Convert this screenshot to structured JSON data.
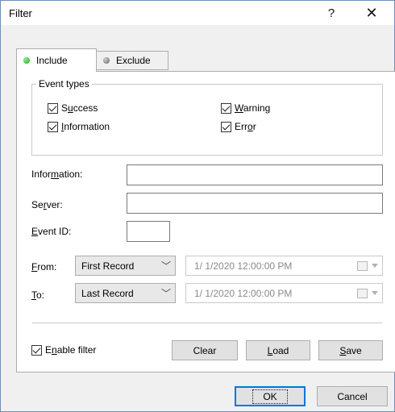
{
  "window": {
    "title": "Filter",
    "help_label": "?",
    "close_label": "✕"
  },
  "tabs": [
    {
      "label": "Include",
      "icon": "green-dot-icon",
      "active": true
    },
    {
      "label": "Exclude",
      "icon": "gray-dot-icon",
      "active": false
    }
  ],
  "event_types": {
    "legend": "Event types",
    "items": [
      {
        "pre": "S",
        "acc": "u",
        "post": "ccess",
        "checked": true
      },
      {
        "pre": "",
        "acc": "I",
        "post": "nformation",
        "checked": true
      },
      {
        "pre": "",
        "acc": "W",
        "post": "arning",
        "checked": true
      },
      {
        "pre": "Err",
        "acc": "o",
        "post": "r",
        "checked": true
      }
    ]
  },
  "fields": {
    "information": {
      "pre": "Infor",
      "acc": "m",
      "post": "ation:",
      "value": ""
    },
    "server": {
      "pre": "Se",
      "acc": "r",
      "post": "ver:",
      "value": ""
    },
    "event_id": {
      "pre": "",
      "acc": "E",
      "post": "vent ID:",
      "value": ""
    }
  },
  "range": {
    "from": {
      "pre": "",
      "acc": "F",
      "post": "rom:",
      "select": "First Record",
      "date": "1/  1/2020 12:00:00 PM"
    },
    "to": {
      "pre": "",
      "acc": "T",
      "post": "o:",
      "select": "Last Record",
      "date": "1/  1/2020 12:00:00 PM"
    }
  },
  "enable_filter": {
    "pre": "E",
    "acc": "n",
    "post": "able filter",
    "checked": true
  },
  "buttons": {
    "clear": {
      "pre": "Clear",
      "acc": "",
      "post": ""
    },
    "load": {
      "pre": "",
      "acc": "L",
      "post": "oad"
    },
    "save": {
      "pre": "",
      "acc": "S",
      "post": "ave"
    },
    "ok": "OK",
    "cancel": "Cancel"
  }
}
